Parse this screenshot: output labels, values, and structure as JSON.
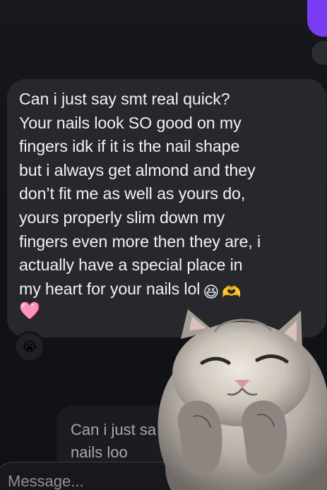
{
  "message": {
    "lines": "Can i just say smt real quick?\nYour nails look SO good on my\nfingers idk if it is the nail shape\nbut i always get almond and they\ndon’t fit me as well as yours do,\nyours properly slim down my\nfingers even more then they are, i\nactually have a special place in\nmy heart for your nails lol",
    "emoji_1": "😆",
    "emoji_2": "🫶",
    "emoji_3": "🩷"
  },
  "reaction": {
    "emoji": "😭"
  },
  "reply_preview": {
    "text": "Can i just sa\nnails loo"
  },
  "composer": {
    "placeholder": "Message..."
  },
  "colors": {
    "background": "#111317",
    "bubble": "#26282c",
    "sent_bubble": "#7a3cf2",
    "text": "#f2f2f2"
  },
  "sticker": {
    "icon": "cat-sticker"
  }
}
